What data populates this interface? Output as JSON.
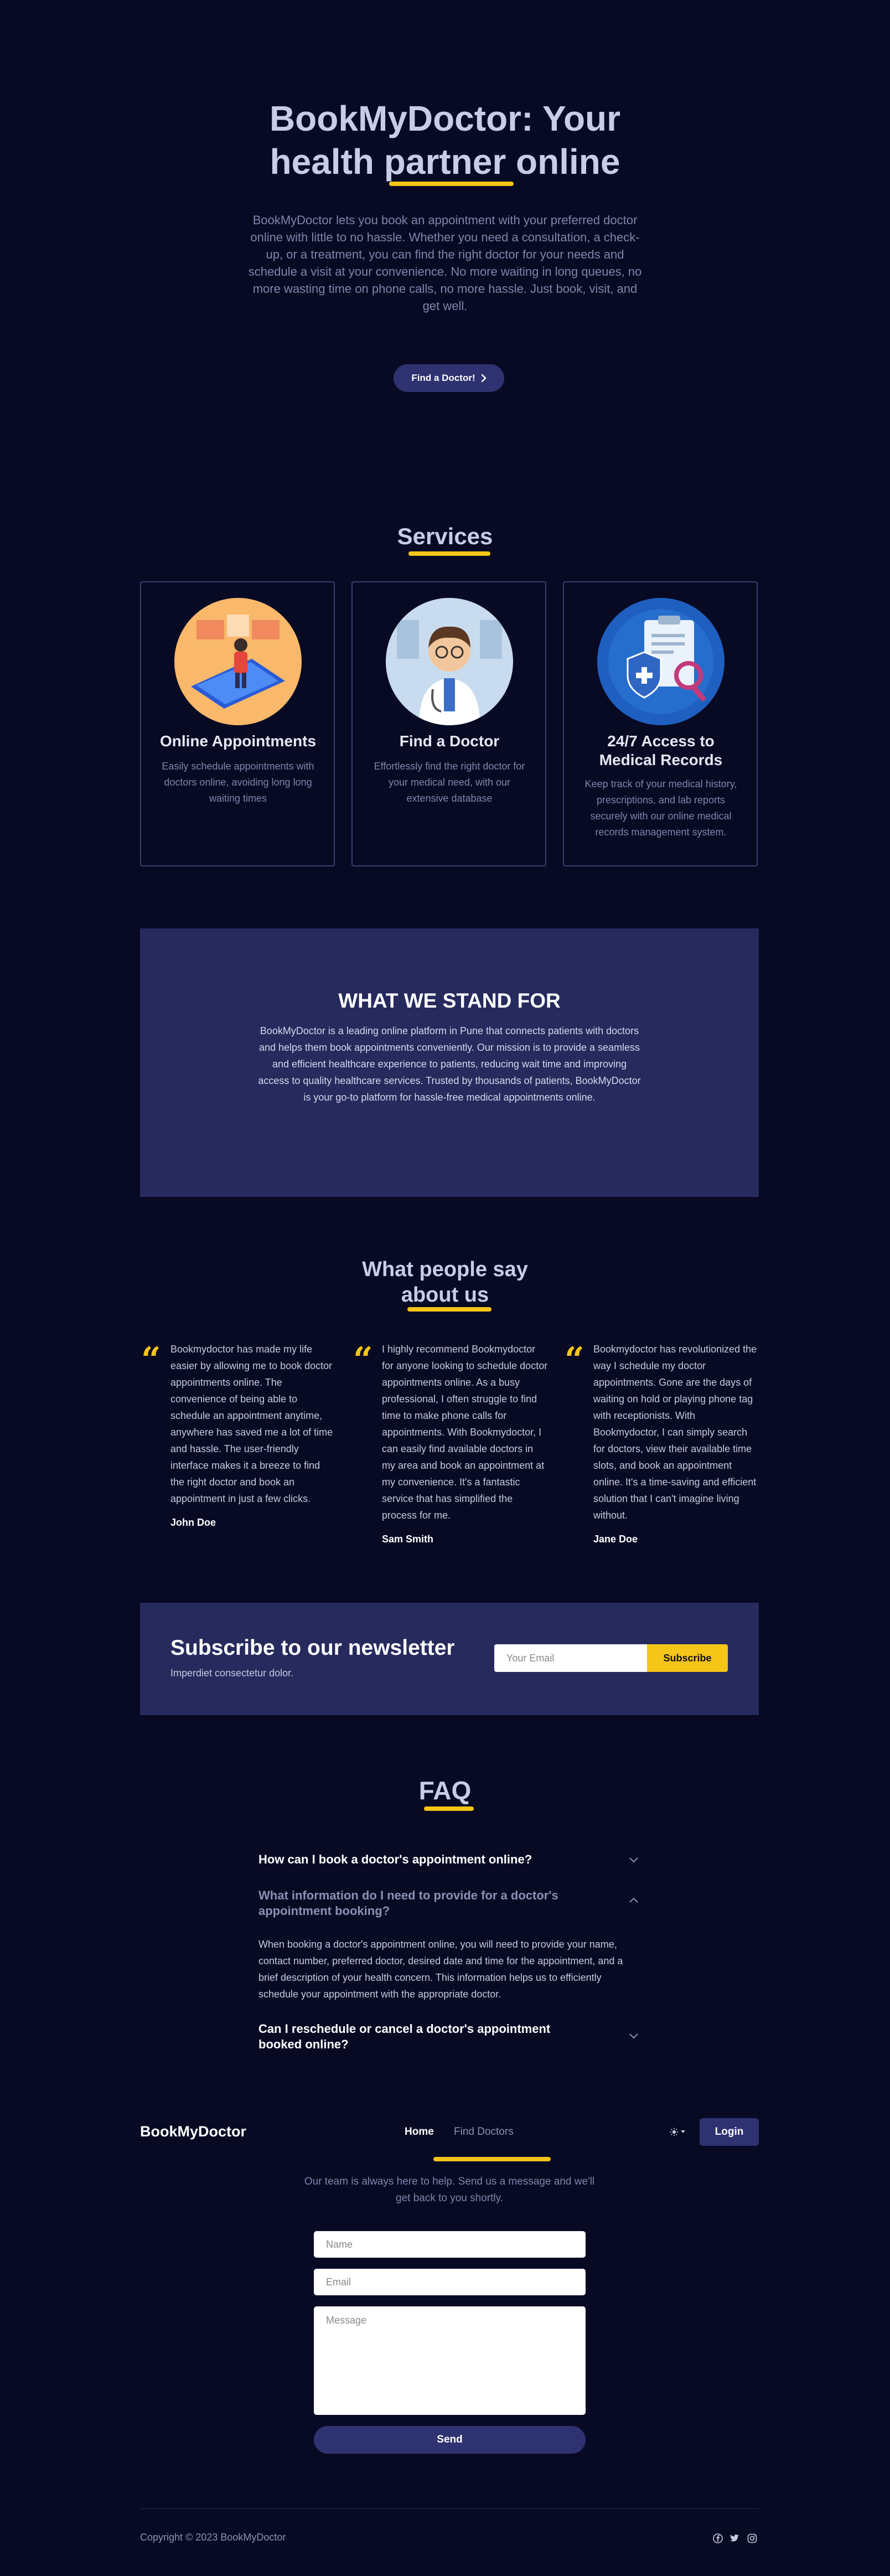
{
  "hero": {
    "title_line1": "BookMyDoctor: Your",
    "title_line2_pre": "health ",
    "title_line2_highlight": "partner",
    "title_line2_post": " online",
    "description": "BookMyDoctor lets you book an appointment with your preferred doctor online with little to no hassle. Whether you need a consultation, a check-up, or a treatment, you can find the right doctor for your needs and schedule a visit at your convenience. No more waiting in long queues, no more wasting time on phone calls, no more hassle. Just book, visit, and get well.",
    "cta_label": "Find a Doctor!",
    "cta_icon": "chevron-right-icon"
  },
  "services": {
    "title": "Services",
    "items": [
      {
        "title": "Online Appointments",
        "description": "Easily schedule appointments with doctors online, avoiding long long waiting times"
      },
      {
        "title": "Find a Doctor",
        "description": "Effortlessly find the right doctor for your medical need, with our extensive database"
      },
      {
        "title_line1": "24/7 Access to",
        "title_line2": "Medical Records",
        "description": "Keep track of your medical history, prescriptions, and lab reports securely with our online medical records management system."
      }
    ]
  },
  "stand_for": {
    "title": "WHAT WE STAND FOR",
    "description": "BookMyDoctor is a leading online platform in Pune that connects patients with doctors and helps them book appointments conveniently. Our mission is to provide a seamless and efficient healthcare experience to patients, reducing wait time and improving access to quality healthcare services. Trusted by thousands of patients, BookMyDoctor is your go-to platform for hassle-free medical appointments online."
  },
  "testimonials": {
    "title_line1": "What people say",
    "title_line2": "about us",
    "quote_mark": "“",
    "items": [
      {
        "text": "Bookmydoctor has made my life easier by allowing me to book doctor appointments online. The convenience of being able to schedule an appointment anytime, anywhere has saved me a lot of time and hassle. The user-friendly interface makes it a breeze to find the right doctor and book an appointment in just a few clicks.",
        "name": "John Doe"
      },
      {
        "text": "I highly recommend Bookmydoctor for anyone looking to schedule doctor appointments online. As a busy professional, I often struggle to find time to make phone calls for appointments. With Bookmydoctor, I can easily find available doctors in my area and book an appointment at my convenience. It's a fantastic service that has simplified the process for me.",
        "name": "Sam Smith"
      },
      {
        "text": "Bookmydoctor has revolutionized the way I schedule my doctor appointments. Gone are the days of waiting on hold or playing phone tag with receptionists. With Bookmydoctor, I can simply search for doctors, view their available time slots, and book an appointment online. It's a time-saving and efficient solution that I can't imagine living without.",
        "name": "Jane Doe"
      }
    ]
  },
  "newsletter": {
    "title": "Subscribe to our newsletter",
    "subtitle": "Imperdiet consectetur dolor.",
    "email_placeholder": "Your Email",
    "button_label": "Subscribe"
  },
  "faq": {
    "title": "FAQ",
    "items": [
      {
        "question": "How can I book a doctor's appointment online?",
        "expanded": false
      },
      {
        "question": "What information do I need to provide for a doctor's appointment booking?",
        "expanded": true,
        "answer": "When booking a doctor's appointment online, you will need to provide your name, contact number, preferred doctor, desired date and time for the appointment, and a brief description of your health concern. This information helps us to efficiently schedule your appointment with the appropriate doctor."
      },
      {
        "question": "Can I reschedule or cancel a doctor's appointment booked online?",
        "expanded": false
      }
    ]
  },
  "navbar": {
    "brand": "BookMyDoctor",
    "links": [
      "Home",
      "Find Doctors"
    ],
    "active_link": "Home",
    "theme_icon": "sun-icon",
    "login_label": "Login"
  },
  "contact": {
    "description": "Our team is always here to help. Send us a message and we'll get back to you shortly.",
    "name_placeholder": "Name",
    "email_placeholder": "Email",
    "message_placeholder": "Message",
    "send_label": "Send"
  },
  "footer": {
    "copyright": "Copyright © 2023 BookMyDoctor",
    "social_icons": [
      "facebook-icon",
      "twitter-icon",
      "instagram-icon"
    ]
  },
  "colors": {
    "background": "#080a24",
    "panel": "#262a5d",
    "accent": "#f5c518",
    "button": "#2e3270"
  }
}
